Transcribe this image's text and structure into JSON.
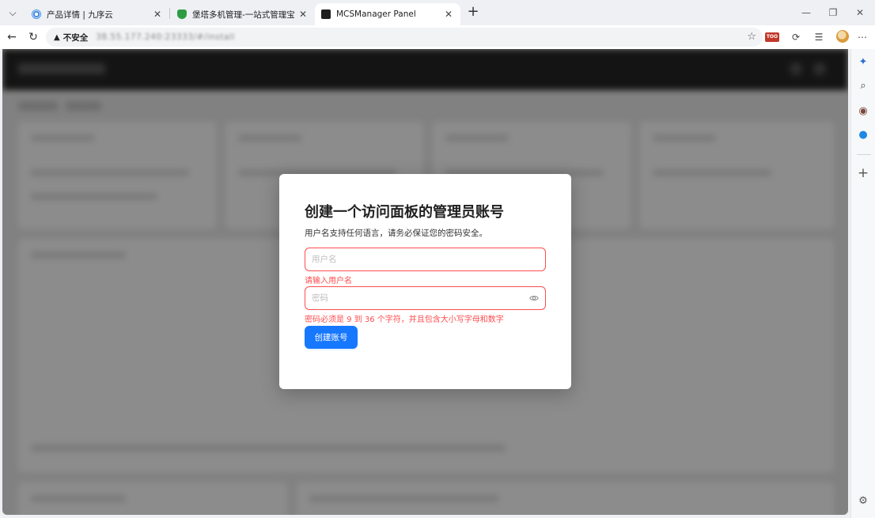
{
  "browser": {
    "tabs": [
      {
        "title": "产品详情 | 九序云",
        "favicon": "cloud-icon",
        "active": false
      },
      {
        "title": "堡塔多机管理-一站式管理宝塔面板",
        "favicon": "shield-icon",
        "active": false
      },
      {
        "title": "MCSManager Panel",
        "favicon": "terminal-icon",
        "active": true
      }
    ],
    "security_label": "不安全",
    "url": "38.55.177.240:23333/#/install",
    "ext_badge": "TOO"
  },
  "modal": {
    "title": "创建一个访问面板的管理员账号",
    "subtitle": "用户名支持任何语言，请务必保证您的密码安全。",
    "username_placeholder": "用户名",
    "username_error": "请输入用户名",
    "password_placeholder": "密码",
    "password_error": "密码必须是 9 到 36 个字符，并且包含大小写字母和数字",
    "create_button": "创建账号"
  },
  "colors": {
    "primary": "#1677ff",
    "error": "#ff4d4f",
    "header_dark": "#262626"
  }
}
